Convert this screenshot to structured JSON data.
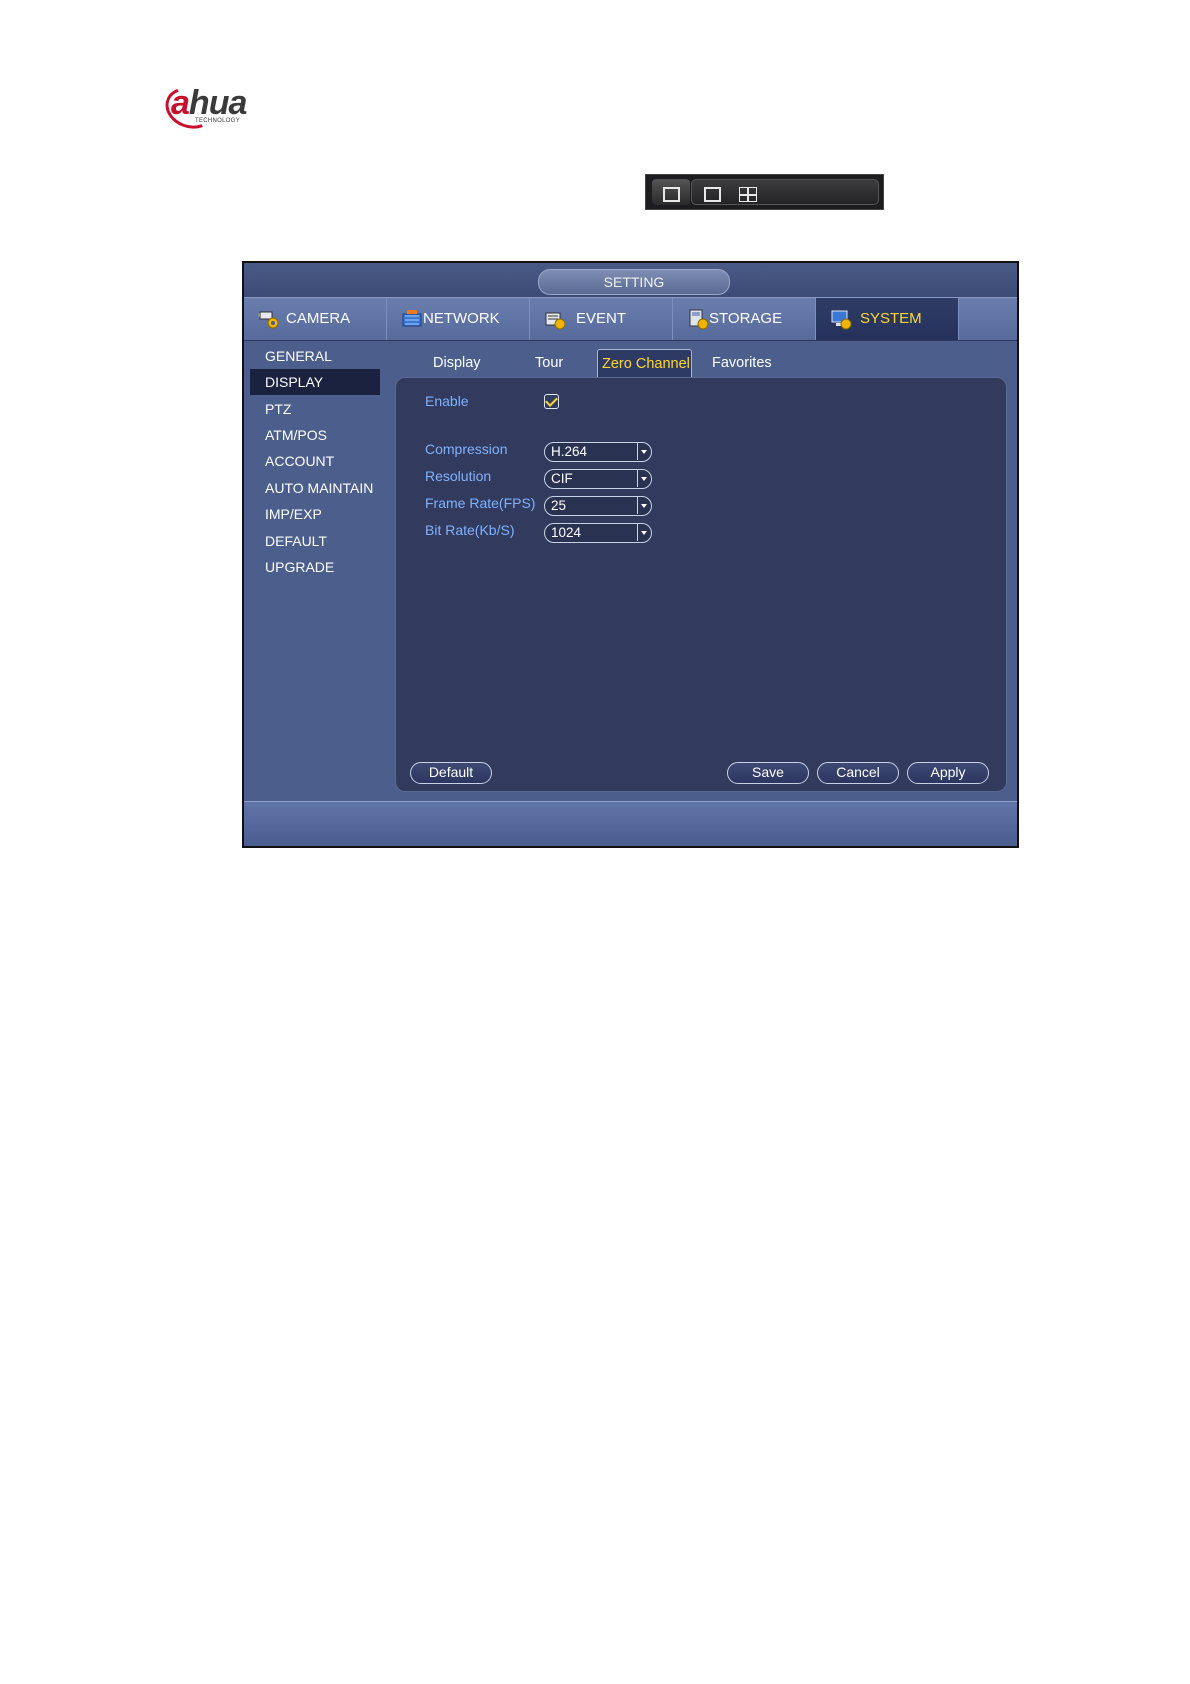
{
  "logo": {
    "brand_a": "a",
    "brand_rest": "hua",
    "sub": "TECHNOLOGY"
  },
  "window": {
    "title": "SETTING"
  },
  "main_tabs": [
    {
      "label": "CAMERA",
      "icon": "camera-icon"
    },
    {
      "label": "NETWORK",
      "icon": "network-icon"
    },
    {
      "label": "EVENT",
      "icon": "event-icon"
    },
    {
      "label": "STORAGE",
      "icon": "storage-icon"
    },
    {
      "label": "SYSTEM",
      "icon": "system-icon"
    }
  ],
  "sidebar": {
    "items": [
      "GENERAL",
      "DISPLAY",
      "PTZ",
      "ATM/POS",
      "ACCOUNT",
      "AUTO MAINTAIN",
      "IMP/EXP",
      "DEFAULT",
      "UPGRADE"
    ],
    "active": "DISPLAY"
  },
  "sub_tabs": [
    "Display",
    "Tour",
    "Zero Channel",
    "Favorites"
  ],
  "active_sub_tab": "Zero Channel",
  "form": {
    "enable_label": "Enable",
    "enable_checked": true,
    "compression_label": "Compression",
    "compression_value": "H.264",
    "resolution_label": "Resolution",
    "resolution_value": "CIF",
    "frame_rate_label": "Frame Rate(FPS)",
    "frame_rate_value": "25",
    "bit_rate_label": "Bit Rate(Kb/S)",
    "bit_rate_value": "1024"
  },
  "buttons": {
    "default": "Default",
    "save": "Save",
    "cancel": "Cancel",
    "apply": "Apply"
  },
  "colors": {
    "active_text": "#ffd633",
    "label_blue": "#7fb2ff",
    "panel_bg": "#323b5e",
    "window_bg": "#4b5e8c"
  }
}
